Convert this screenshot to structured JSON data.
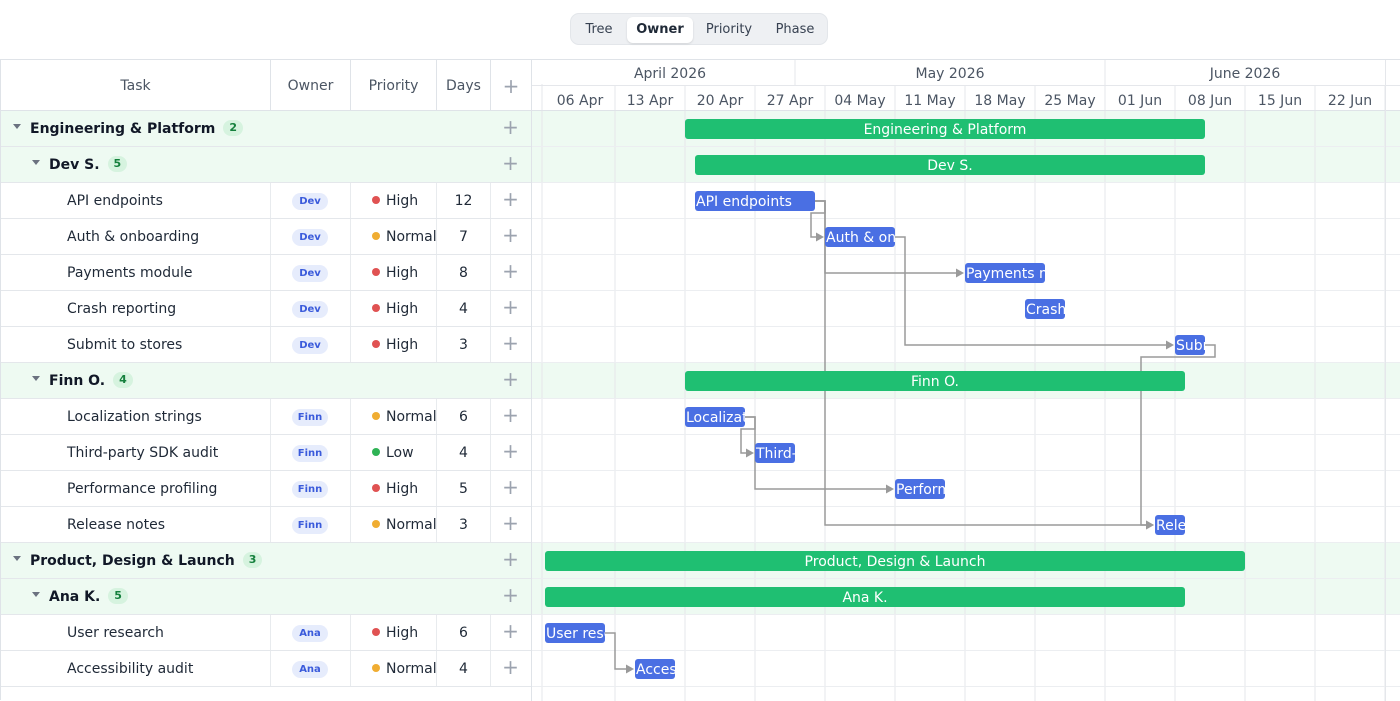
{
  "view_switcher": {
    "options": [
      "Tree",
      "Owner",
      "Priority",
      "Phase"
    ],
    "active": "Owner"
  },
  "grid": {
    "columns": {
      "task": "Task",
      "owner": "Owner",
      "priority": "Priority",
      "days": "Days",
      "add": "+"
    }
  },
  "timeline": {
    "months": [
      "April 2026",
      "May 2026",
      "June 2026"
    ],
    "weeks": [
      "06 Apr",
      "13 Apr",
      "20 Apr",
      "27 Apr",
      "04 May",
      "11 May",
      "18 May",
      "25 May",
      "01 Jun",
      "08 Jun",
      "15 Jun",
      "22 Jun"
    ],
    "week_starts": [
      "2026-04-06",
      "2026-04-13",
      "2026-04-20",
      "2026-04-27",
      "2026-05-04",
      "2026-05-11",
      "2026-05-18",
      "2026-05-25",
      "2026-06-01",
      "2026-06-08",
      "2026-06-15",
      "2026-06-22"
    ]
  },
  "priority_colors": {
    "High": "#e05252",
    "Normal": "#f0ad32",
    "Low": "#2fb355"
  },
  "colors": {
    "group_bar": "#1fbf72",
    "task_bar": "#4a6fe3",
    "link": "#9a9a9a"
  },
  "rows": [
    {
      "kind": "group",
      "level": 0,
      "name": "Engineering & Platform",
      "count": "2",
      "start": "2026-04-20",
      "end": "2026-06-11"
    },
    {
      "kind": "group",
      "level": 1,
      "name": "Dev S.",
      "count": "5",
      "start": "2026-04-21",
      "end": "2026-06-11"
    },
    {
      "kind": "task",
      "name": "API endpoints",
      "owner": "Dev",
      "priority": "High",
      "days": "12",
      "start": "2026-04-21",
      "end": "2026-05-03"
    },
    {
      "kind": "task",
      "name": "Auth & onboarding",
      "owner": "Dev",
      "priority": "Normal",
      "days": "7",
      "start": "2026-05-04",
      "end": "2026-05-11"
    },
    {
      "kind": "task",
      "name": "Payments module",
      "owner": "Dev",
      "priority": "High",
      "days": "8",
      "start": "2026-05-18",
      "end": "2026-05-26"
    },
    {
      "kind": "task",
      "name": "Crash reporting",
      "owner": "Dev",
      "priority": "High",
      "days": "4",
      "start": "2026-05-24",
      "end": "2026-05-28"
    },
    {
      "kind": "task",
      "name": "Submit to stores",
      "owner": "Dev",
      "priority": "High",
      "days": "3",
      "start": "2026-06-08",
      "end": "2026-06-11"
    },
    {
      "kind": "group",
      "level": 1,
      "name": "Finn O.",
      "count": "4",
      "start": "2026-04-20",
      "end": "2026-06-09"
    },
    {
      "kind": "task",
      "name": "Localization strings",
      "owner": "Finn",
      "priority": "Normal",
      "days": "6",
      "start": "2026-04-20",
      "end": "2026-04-26"
    },
    {
      "kind": "task",
      "name": "Third-party SDK audit",
      "owner": "Finn",
      "priority": "Low",
      "days": "4",
      "start": "2026-04-27",
      "end": "2026-05-01"
    },
    {
      "kind": "task",
      "name": "Performance profiling",
      "owner": "Finn",
      "priority": "High",
      "days": "5",
      "start": "2026-05-11",
      "end": "2026-05-16"
    },
    {
      "kind": "task",
      "name": "Release notes",
      "owner": "Finn",
      "priority": "Normal",
      "days": "3",
      "start": "2026-06-06",
      "end": "2026-06-09"
    },
    {
      "kind": "group",
      "level": 0,
      "name": "Product, Design & Launch",
      "count": "3",
      "start": "2026-04-06",
      "end": "2026-06-15"
    },
    {
      "kind": "group",
      "level": 1,
      "name": "Ana K.",
      "count": "5",
      "start": "2026-04-06",
      "end": "2026-06-09"
    },
    {
      "kind": "task",
      "name": "User research",
      "owner": "Ana",
      "priority": "High",
      "days": "6",
      "start": "2026-04-06",
      "end": "2026-04-12"
    },
    {
      "kind": "task",
      "name": "Accessibility audit",
      "owner": "Ana",
      "priority": "Normal",
      "days": "4",
      "start": "2026-04-15",
      "end": "2026-04-19"
    }
  ],
  "bar_labels": {
    "0": "Engineering & Platform",
    "1": "Dev S.",
    "2": "API endpoints",
    "3": "Auth & onb",
    "4": "Payments m",
    "5": "Crash",
    "6": "Subr",
    "7": "Finn O.",
    "8": "Localizat",
    "9": "Third-",
    "10": "Perform",
    "11": "Rele",
    "12": "Product, Design & Launch",
    "13": "Ana K.",
    "14": "User rese",
    "15": "Acces"
  },
  "dependencies": [
    {
      "from": 2,
      "to": 3
    },
    {
      "from": 2,
      "to": 4
    },
    {
      "from": 8,
      "to": 9
    },
    {
      "from": 8,
      "to": 10
    },
    {
      "from": 14,
      "to": 15
    },
    {
      "from": 6,
      "to": 11
    },
    {
      "from": 2,
      "to": 11
    },
    {
      "from": 3,
      "to": 6
    }
  ]
}
